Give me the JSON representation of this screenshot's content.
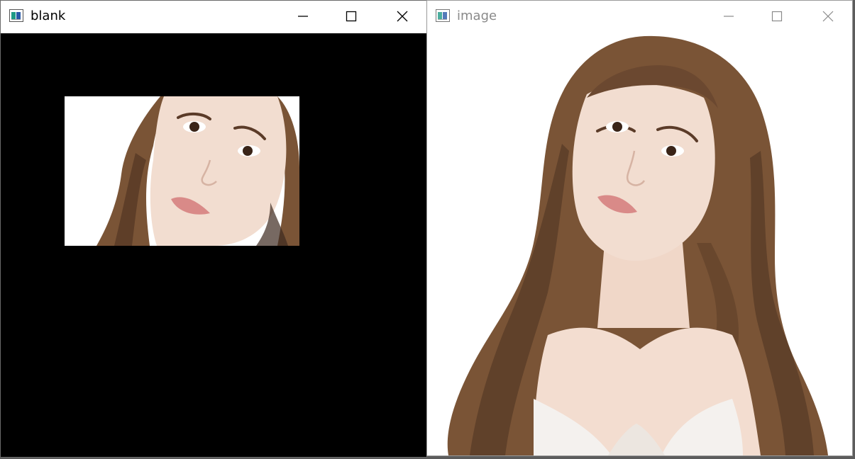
{
  "windows": {
    "blank": {
      "title": "blank",
      "icon": "app-window-icon",
      "controls": [
        "minimize-icon",
        "maximize-icon",
        "close-icon"
      ],
      "content_background": "#000000"
    },
    "image": {
      "title": "image",
      "icon": "app-window-icon",
      "controls": [
        "minimize-icon",
        "maximize-icon",
        "close-icon"
      ],
      "content_background": "#ffffff",
      "active": false
    }
  },
  "colors": {
    "icon_teal": "#1f9a86",
    "icon_blue": "#2a5aa8",
    "icon_border": "#555555",
    "hair": "#7a5436",
    "hair_dark": "#4b3120",
    "skin": "#f2ddd0",
    "lips": "#d98a88",
    "dress": "#f4f1ee"
  }
}
